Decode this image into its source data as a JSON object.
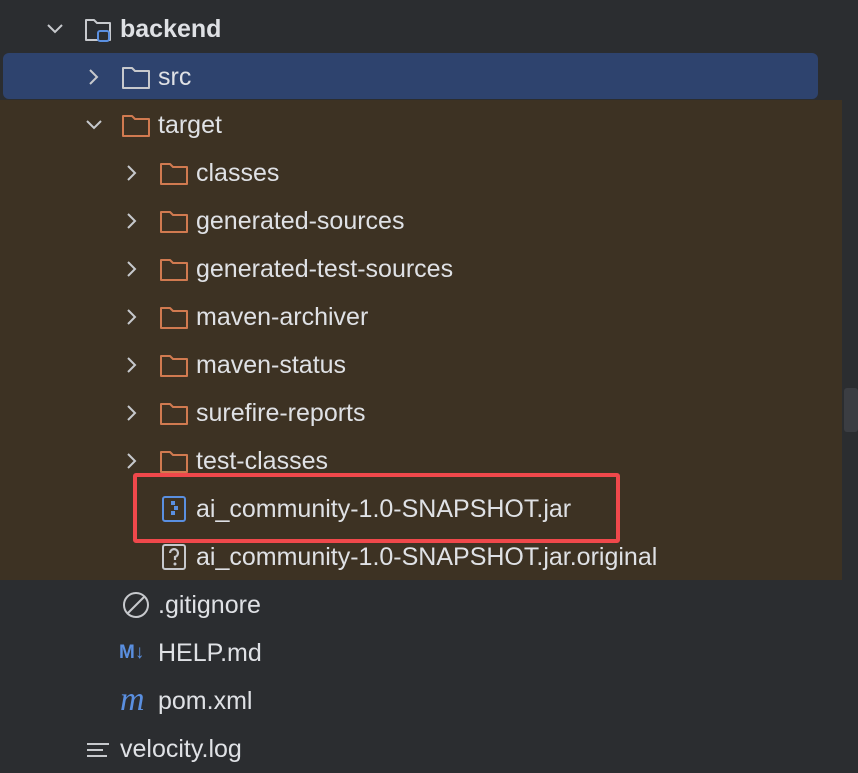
{
  "tree": {
    "root": {
      "label": "backend",
      "expanded": true
    },
    "src": {
      "label": "src",
      "expanded": false,
      "selected": true
    },
    "target": {
      "label": "target",
      "expanded": true
    },
    "target_children": [
      {
        "label": "classes",
        "type": "folder"
      },
      {
        "label": "generated-sources",
        "type": "folder"
      },
      {
        "label": "generated-test-sources",
        "type": "folder"
      },
      {
        "label": "maven-archiver",
        "type": "folder"
      },
      {
        "label": "maven-status",
        "type": "folder"
      },
      {
        "label": "surefire-reports",
        "type": "folder"
      },
      {
        "label": "test-classes",
        "type": "folder"
      }
    ],
    "jar_file": {
      "label": "ai_community-1.0-SNAPSHOT.jar",
      "icon": "jar-icon",
      "highlighted": true
    },
    "jar_original": {
      "label": "ai_community-1.0-SNAPSHOT.jar.original",
      "icon": "unknown-file-icon"
    },
    "gitignore": {
      "label": ".gitignore",
      "icon": "ignore-icon"
    },
    "help_md": {
      "label": "HELP.md",
      "icon": "markdown-icon",
      "icon_text": "M↓"
    },
    "pom_xml": {
      "label": "pom.xml",
      "icon": "maven-icon",
      "icon_text": "m"
    },
    "velocity_log": {
      "label": "velocity.log",
      "icon": "text-file-icon"
    }
  },
  "colors": {
    "background": "#2b2d30",
    "selection": "#2e436e",
    "excluded_folder_bg": "#3d3223",
    "folder_outline": "#d17a50",
    "highlight_border": "#f0484b",
    "accent_blue": "#5a8fe0"
  }
}
